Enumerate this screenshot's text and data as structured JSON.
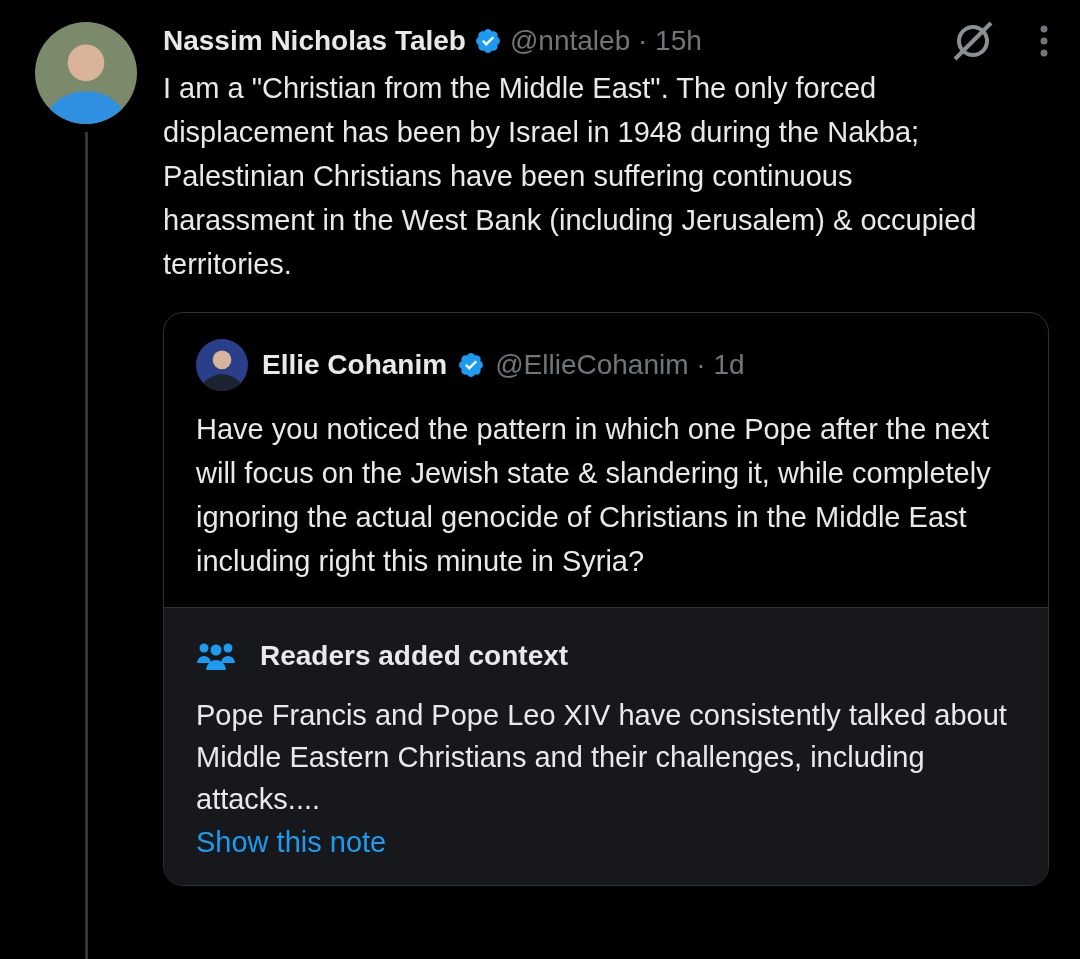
{
  "post": {
    "author": "Nassim Nicholas Taleb",
    "verified": true,
    "meta": "@nntaleb · 15h",
    "text": "I am a \"Christian from the Middle East\". The only forced displacement has been by Israel in 1948 during the Nakba; Palestinian Christians have been suffering continuous harassment in the West Bank (including Jerusalem) & occupied territories."
  },
  "quote": {
    "author": "Ellie Cohanim",
    "verified": true,
    "meta": "@EllieCohanim · 1d",
    "text": "Have you noticed the pattern in which one Pope after the next will focus on the Jewish state & slandering it, while completely ignoring the actual genocide of Christians in the Middle East including right this minute in Syria?"
  },
  "note": {
    "title": "Readers added context",
    "text": "Pope Francis and Pope Leo XIV have consistently talked about Middle Eastern Christians and their challenges, including attacks....",
    "link": "Show this note"
  }
}
